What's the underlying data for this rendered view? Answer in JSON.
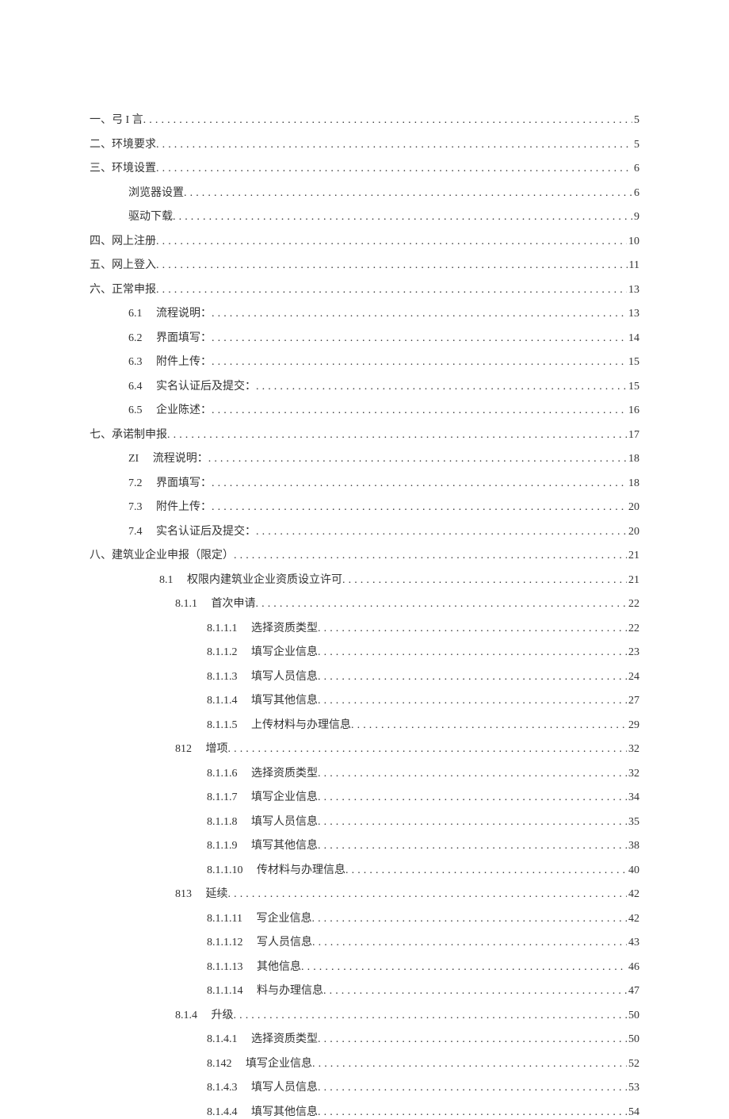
{
  "toc": [
    {
      "level": "lvl0",
      "num": "一、",
      "title": "弓 I 言",
      "page": "5"
    },
    {
      "level": "lvl0",
      "num": "二、",
      "title": "环境要求 ",
      "page": "5"
    },
    {
      "level": "lvl0",
      "num": "三、",
      "title": "环境设置 ",
      "page": "6"
    },
    {
      "level": "lvl1",
      "num": "",
      "title": "浏览器设置 ",
      "page": "6"
    },
    {
      "level": "lvl1",
      "num": "",
      "title": "驱动下载 ",
      "page": "9"
    },
    {
      "level": "lvl0",
      "num": "四、",
      "title": "网上注册 ",
      "page": "10"
    },
    {
      "level": "lvl0",
      "num": "五、",
      "title": "网上登入 ",
      "page": "11"
    },
    {
      "level": "lvl0",
      "num": "六、",
      "title": "正常申报 ",
      "page": "13"
    },
    {
      "level": "lvl2",
      "num": "6.1",
      "title": "流程说明：",
      "page": "13"
    },
    {
      "level": "lvl2",
      "num": "6.2",
      "title": "界面填写：",
      "page": "14"
    },
    {
      "level": "lvl2",
      "num": "6.3",
      "title": "附件上传：",
      "page": "15"
    },
    {
      "level": "lvl2",
      "num": "6.4",
      "title": "实名认证后及提交：",
      "page": "15"
    },
    {
      "level": "lvl2",
      "num": "6.5",
      "title": "企业陈述：",
      "page": "16"
    },
    {
      "level": "lvl0",
      "num": "七、",
      "title": "承诺制申报 ",
      "page": "17"
    },
    {
      "level": "lvl2",
      "num": "ZI",
      "title": "流程说明：",
      "page": "18"
    },
    {
      "level": "lvl2",
      "num": "7.2",
      "title": "界面填写：",
      "page": "18"
    },
    {
      "level": "lvl2",
      "num": "7.3",
      "title": "附件上传：",
      "page": "20"
    },
    {
      "level": "lvl2",
      "num": "7.4",
      "title": "实名认证后及提交：",
      "page": "20"
    },
    {
      "level": "lvl0",
      "num": "八、",
      "title": "建筑业企业申报（限定）",
      "page": "21"
    },
    {
      "level": "lvl3",
      "num": "8.1",
      "title": "权限内建筑业企业资质设立许可 ",
      "page": "21"
    },
    {
      "level": "lvl4",
      "num": "8.1.1",
      "title": "首次申请 ",
      "page": "22"
    },
    {
      "level": "lvl5",
      "num": "8.1.1.1",
      "title": "选择资质类型",
      "page": "22"
    },
    {
      "level": "lvl5",
      "num": "8.1.1.2",
      "title": "填写企业信息",
      "page": "23"
    },
    {
      "level": "lvl5",
      "num": "8.1.1.3",
      "title": "填写人员信息",
      "page": "24"
    },
    {
      "level": "lvl5",
      "num": "8.1.1.4",
      "title": "填写其他信息",
      "page": "27"
    },
    {
      "level": "lvl5",
      "num": "8.1.1.5",
      "title": "上传材料与办理信息",
      "page": "29"
    },
    {
      "level": "lvl4",
      "num": "812",
      "title": "增项",
      "page": "32"
    },
    {
      "level": "lvl5",
      "num": "8.1.1.6",
      "title": "选择资质类型 ",
      "page": "32"
    },
    {
      "level": "lvl5",
      "num": "8.1.1.7",
      "title": "填写企业信息",
      "page": "34"
    },
    {
      "level": "lvl5",
      "num": "8.1.1.8",
      "title": "填写人员信息",
      "page": "35"
    },
    {
      "level": "lvl5",
      "num": "8.1.1.9",
      "title": "填写其他信息",
      "page": "38"
    },
    {
      "level": "lvl5b",
      "num": "8.1.1.10",
      "title": "   传材料与办理信息",
      "page": "40"
    },
    {
      "level": "lvl4",
      "num": "813",
      "title": "延续",
      "page": "42"
    },
    {
      "level": "lvl5b",
      "num": "8.1.1.11",
      "title": "  写企业信息 ",
      "page": "42"
    },
    {
      "level": "lvl5b",
      "num": "8.1.1.12",
      "title": "  写人员信息",
      "page": "43"
    },
    {
      "level": "lvl5b",
      "num": "8.1.1.13",
      "title": "  其他信息",
      "page": "46"
    },
    {
      "level": "lvl5b",
      "num": "8.1.1.14",
      "title": "    料与办理信息 ",
      "page": "47"
    },
    {
      "level": "lvl4",
      "num": "8.1.4",
      "title": "升级",
      "page": "50"
    },
    {
      "level": "lvl5",
      "num": "8.1.4.1",
      "title": "选择资质类型 ",
      "page": "50"
    },
    {
      "level": "lvl5",
      "num": "8.142",
      "title": "填写企业信息 ",
      "page": "52"
    },
    {
      "level": "lvl5",
      "num": "8.1.4.3",
      "title": "填写人员信息 ",
      "page": "53"
    },
    {
      "level": "lvl5",
      "num": "8.1.4.4",
      "title": "填写其他信息 ",
      "page": "54"
    }
  ]
}
